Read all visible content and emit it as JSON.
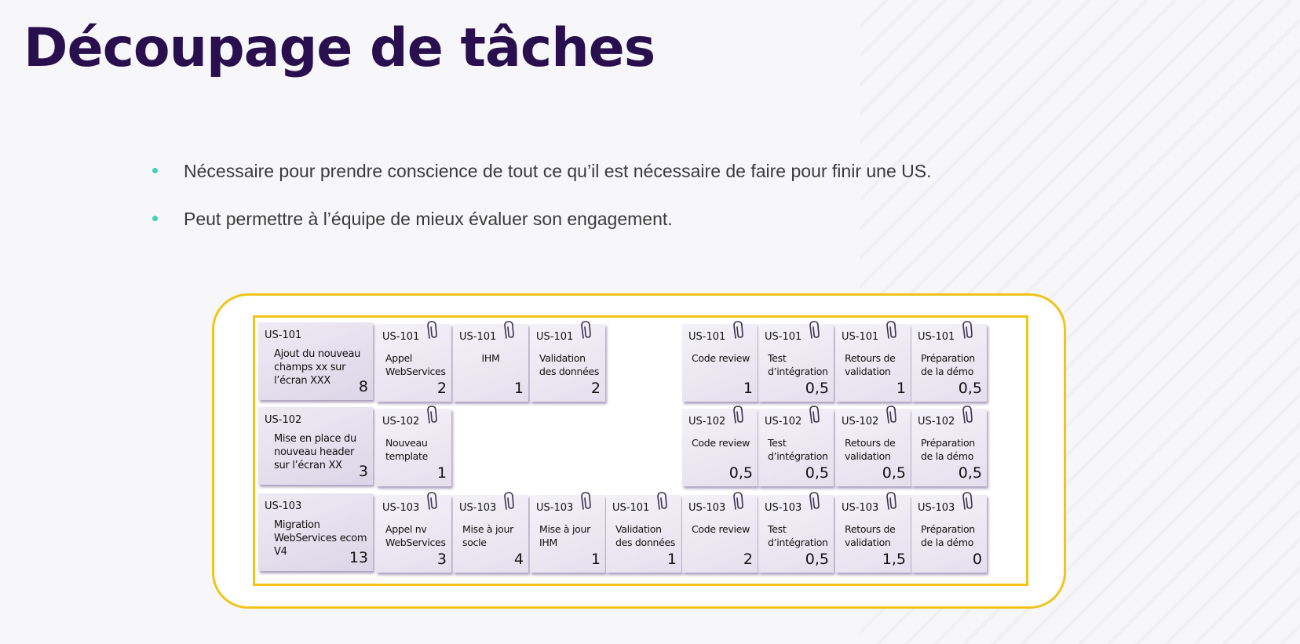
{
  "title": "Découpage de tâches",
  "bullets": [
    "Nécessaire pour prendre conscience de tout ce qu’il est nécessaire de  faire pour finir une US.",
    "Peut permettre à l’équipe de mieux évaluer son engagement."
  ],
  "colors": {
    "title": "#2a0f4f",
    "bullet": "#43d0b7",
    "frame": "#f2c318"
  },
  "board": {
    "rows": [
      {
        "story": {
          "id": "US-101",
          "text": "Ajout du nouveau champs xx sur l’écran XXX",
          "points": "8"
        },
        "tasks": [
          {
            "col": 0,
            "id": "US-101",
            "text": "Appel WebServices",
            "points": "2"
          },
          {
            "col": 1,
            "id": "US-101",
            "text": "IHM",
            "points": "1"
          },
          {
            "col": 2,
            "id": "US-101",
            "text": "Validation des données",
            "points": "2"
          },
          {
            "col": 4,
            "id": "US-101",
            "text": "Code review",
            "points": "1"
          },
          {
            "col": 5,
            "id": "US-101",
            "text": "Test d’intégration",
            "points": "0,5"
          },
          {
            "col": 6,
            "id": "US-101",
            "text": "Retours de validation",
            "points": "1"
          },
          {
            "col": 7,
            "id": "US-101",
            "text": "Préparation de la démo",
            "points": "0,5"
          }
        ]
      },
      {
        "story": {
          "id": "US-102",
          "text": "Mise en place du nouveau header sur l’écran XX",
          "points": "3"
        },
        "tasks": [
          {
            "col": 0,
            "id": "US-102",
            "text": "Nouveau template",
            "points": "1"
          },
          {
            "col": 4,
            "id": "US-102",
            "text": "Code review",
            "points": "0,5"
          },
          {
            "col": 5,
            "id": "US-102",
            "text": "Test d’intégration",
            "points": "0,5"
          },
          {
            "col": 6,
            "id": "US-102",
            "text": "Retours de validation",
            "points": "0,5"
          },
          {
            "col": 7,
            "id": "US-102",
            "text": "Préparation de la démo",
            "points": "0,5"
          }
        ]
      },
      {
        "story": {
          "id": "US-103",
          "text": "Migration WebServices ecom V4",
          "points": "13"
        },
        "tasks": [
          {
            "col": 0,
            "id": "US-103",
            "text": "Appel nv WebServices",
            "points": "3"
          },
          {
            "col": 1,
            "id": "US-103",
            "text": "Mise à jour socle",
            "points": "4"
          },
          {
            "col": 2,
            "id": "US-103",
            "text": "Mise à jour IHM",
            "points": "1"
          },
          {
            "col": 3,
            "id": "US-101",
            "text": "Validation des données",
            "points": "1"
          },
          {
            "col": 4,
            "id": "US-103",
            "text": "Code review",
            "points": "2"
          },
          {
            "col": 5,
            "id": "US-103",
            "text": "Test d’intégration",
            "points": "0,5"
          },
          {
            "col": 6,
            "id": "US-103",
            "text": "Retours de validation",
            "points": "1,5"
          },
          {
            "col": 7,
            "id": "US-103",
            "text": "Préparation de la démo",
            "points": "0"
          }
        ]
      }
    ]
  }
}
